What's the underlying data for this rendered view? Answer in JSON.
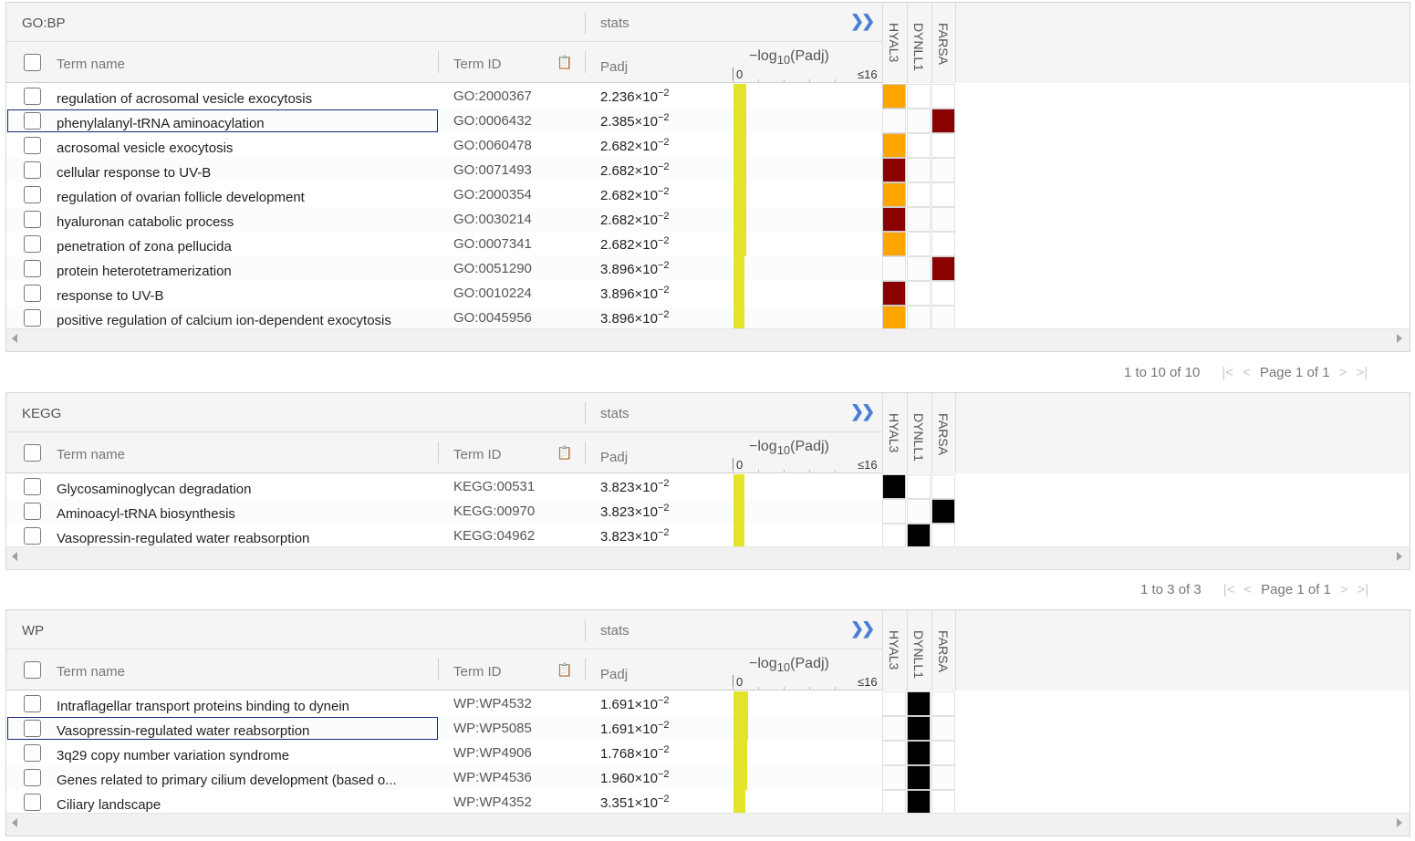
{
  "colors": {
    "bar": "#e3e32a",
    "orange": "#ffa500",
    "darkred": "#8b0000",
    "black": "#000000",
    "expand": "#4a7fd8"
  },
  "columns": {
    "term_name": "Term name",
    "term_id": "Term ID",
    "padj": "Padj",
    "stats": "stats",
    "log_prefix": "−log",
    "log_sub": "10",
    "log_suffix": "(Padj)",
    "axis_min": "0",
    "axis_max": "≤16",
    "expand_icon": "❯❯"
  },
  "genes": [
    "HYAL3",
    "DYNLL1",
    "FARSA"
  ],
  "sections": [
    {
      "id": "gobp",
      "title": "GO:BP",
      "pager": {
        "range": "1 to 10 of 10",
        "page": "Page 1 of 1"
      },
      "rows": [
        {
          "name": "regulation of acrosomal vesicle exocytosis",
          "id": "GO:2000367",
          "padj_mant": "2.236",
          "padj_exp": "−2",
          "padj_value": 0.02236,
          "cells": [
            "orange",
            "",
            ""
          ]
        },
        {
          "name": "phenylalanyl-tRNA aminoacylation",
          "id": "GO:0006432",
          "padj_mant": "2.385",
          "padj_exp": "−2",
          "padj_value": 0.02385,
          "cells": [
            "",
            "",
            "darkred"
          ],
          "selected": true
        },
        {
          "name": "acrosomal vesicle exocytosis",
          "id": "GO:0060478",
          "padj_mant": "2.682",
          "padj_exp": "−2",
          "padj_value": 0.02682,
          "cells": [
            "orange",
            "",
            ""
          ]
        },
        {
          "name": "cellular response to UV-B",
          "id": "GO:0071493",
          "padj_mant": "2.682",
          "padj_exp": "−2",
          "padj_value": 0.02682,
          "cells": [
            "darkred",
            "",
            ""
          ]
        },
        {
          "name": "regulation of ovarian follicle development",
          "id": "GO:2000354",
          "padj_mant": "2.682",
          "padj_exp": "−2",
          "padj_value": 0.02682,
          "cells": [
            "orange",
            "",
            ""
          ]
        },
        {
          "name": "hyaluronan catabolic process",
          "id": "GO:0030214",
          "padj_mant": "2.682",
          "padj_exp": "−2",
          "padj_value": 0.02682,
          "cells": [
            "darkred",
            "",
            ""
          ]
        },
        {
          "name": "penetration of zona pellucida",
          "id": "GO:0007341",
          "padj_mant": "2.682",
          "padj_exp": "−2",
          "padj_value": 0.02682,
          "cells": [
            "orange",
            "",
            ""
          ]
        },
        {
          "name": "protein heterotetramerization",
          "id": "GO:0051290",
          "padj_mant": "3.896",
          "padj_exp": "−2",
          "padj_value": 0.03896,
          "cells": [
            "",
            "",
            "darkred"
          ]
        },
        {
          "name": "response to UV-B",
          "id": "GO:0010224",
          "padj_mant": "3.896",
          "padj_exp": "−2",
          "padj_value": 0.03896,
          "cells": [
            "darkred",
            "",
            ""
          ]
        },
        {
          "name": "positive regulation of calcium ion-dependent exocytosis",
          "id": "GO:0045956",
          "padj_mant": "3.896",
          "padj_exp": "−2",
          "padj_value": 0.03896,
          "cells": [
            "orange",
            "",
            ""
          ]
        }
      ]
    },
    {
      "id": "kegg",
      "title": "KEGG",
      "pager": {
        "range": "1 to 3 of 3",
        "page": "Page 1 of 1"
      },
      "rows": [
        {
          "name": "Glycosaminoglycan degradation",
          "id": "KEGG:00531",
          "padj_mant": "3.823",
          "padj_exp": "−2",
          "padj_value": 0.03823,
          "cells": [
            "black",
            "",
            ""
          ]
        },
        {
          "name": "Aminoacyl-tRNA biosynthesis",
          "id": "KEGG:00970",
          "padj_mant": "3.823",
          "padj_exp": "−2",
          "padj_value": 0.03823,
          "cells": [
            "",
            "",
            "black"
          ]
        },
        {
          "name": "Vasopressin-regulated water reabsorption",
          "id": "KEGG:04962",
          "padj_mant": "3.823",
          "padj_exp": "−2",
          "padj_value": 0.03823,
          "cells": [
            "",
            "black",
            ""
          ]
        }
      ]
    },
    {
      "id": "wp",
      "title": "WP",
      "rows": [
        {
          "name": "Intraflagellar transport proteins binding to dynein",
          "id": "WP:WP4532",
          "padj_mant": "1.691",
          "padj_exp": "−2",
          "padj_value": 0.01691,
          "cells": [
            "",
            "black",
            ""
          ]
        },
        {
          "name": "Vasopressin-regulated water reabsorption",
          "id": "WP:WP5085",
          "padj_mant": "1.691",
          "padj_exp": "−2",
          "padj_value": 0.01691,
          "cells": [
            "",
            "black",
            ""
          ],
          "selected": true
        },
        {
          "name": "3q29 copy number variation syndrome",
          "id": "WP:WP4906",
          "padj_mant": "1.768",
          "padj_exp": "−2",
          "padj_value": 0.01768,
          "cells": [
            "",
            "black",
            ""
          ]
        },
        {
          "name": "Genes related to primary cilium development (based o...",
          "id": "WP:WP4536",
          "padj_mant": "1.960",
          "padj_exp": "−2",
          "padj_value": 0.0196,
          "cells": [
            "",
            "black",
            ""
          ]
        },
        {
          "name": "Ciliary landscape",
          "id": "WP:WP4352",
          "padj_mant": "3.351",
          "padj_exp": "−2",
          "padj_value": 0.03351,
          "cells": [
            "",
            "black",
            ""
          ]
        }
      ]
    }
  ]
}
